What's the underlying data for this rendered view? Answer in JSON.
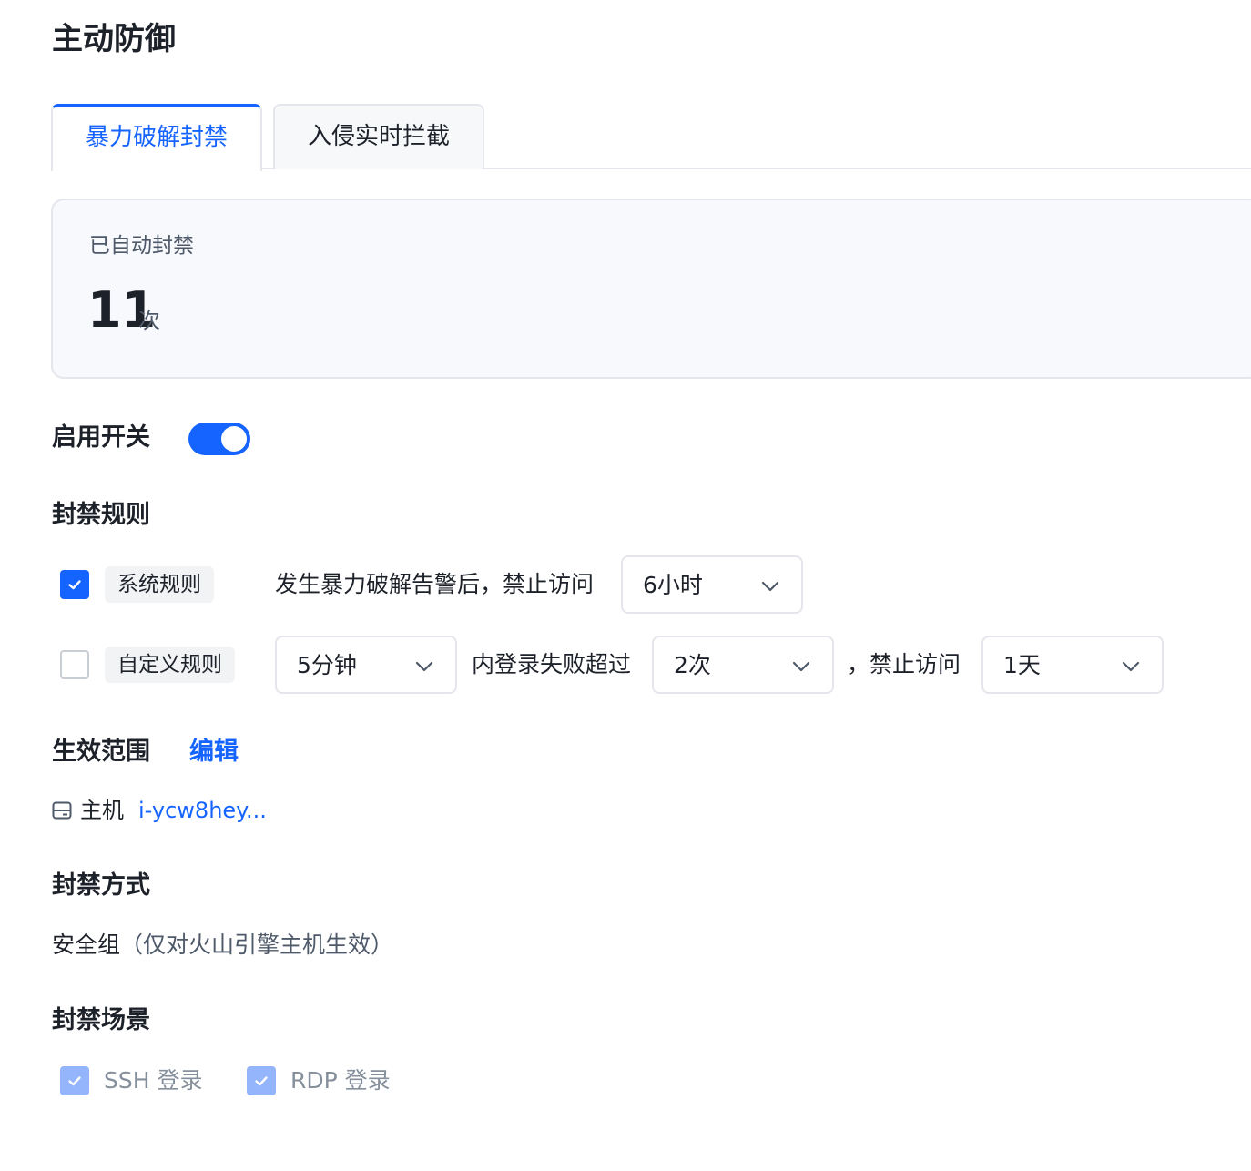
{
  "page": {
    "title": "主动防御"
  },
  "tabs": [
    {
      "label": "暴力破解封禁",
      "active": true
    },
    {
      "label": "入侵实时拦截",
      "active": false
    }
  ],
  "stats": {
    "label": "已自动封禁",
    "value": "11",
    "unit": "次"
  },
  "enable": {
    "label": "启用开关",
    "on": true
  },
  "rules": {
    "label": "封禁规则",
    "system": {
      "checked": true,
      "tag": "系统规则",
      "text": "发生暴力破解告警后，禁止访问",
      "duration": "6小时"
    },
    "custom": {
      "checked": false,
      "tag": "自定义规则",
      "window": "5分钟",
      "text_mid": "内登录失败超过",
      "count": "2次",
      "text_after": "，禁止访问",
      "duration": "1天"
    }
  },
  "scope": {
    "label": "生效范围",
    "edit_label": "编辑",
    "host_label": "主机",
    "host_value": "i-ycw8hey..."
  },
  "method": {
    "label": "封禁方式",
    "value": "安全组",
    "note": "（仅对火山引擎主机生效）"
  },
  "scenes": {
    "label": "封禁场景",
    "items": [
      {
        "label": "SSH 登录",
        "checked": true
      },
      {
        "label": "RDP 登录",
        "checked": true
      }
    ]
  },
  "colors": {
    "primary": "#1664ff",
    "text": "#1d2129",
    "secondary": "#4e5969",
    "disabled": "#86909c"
  },
  "icons": {
    "check": "check-icon",
    "chevron": "chevron-down-icon",
    "host": "server-icon"
  }
}
